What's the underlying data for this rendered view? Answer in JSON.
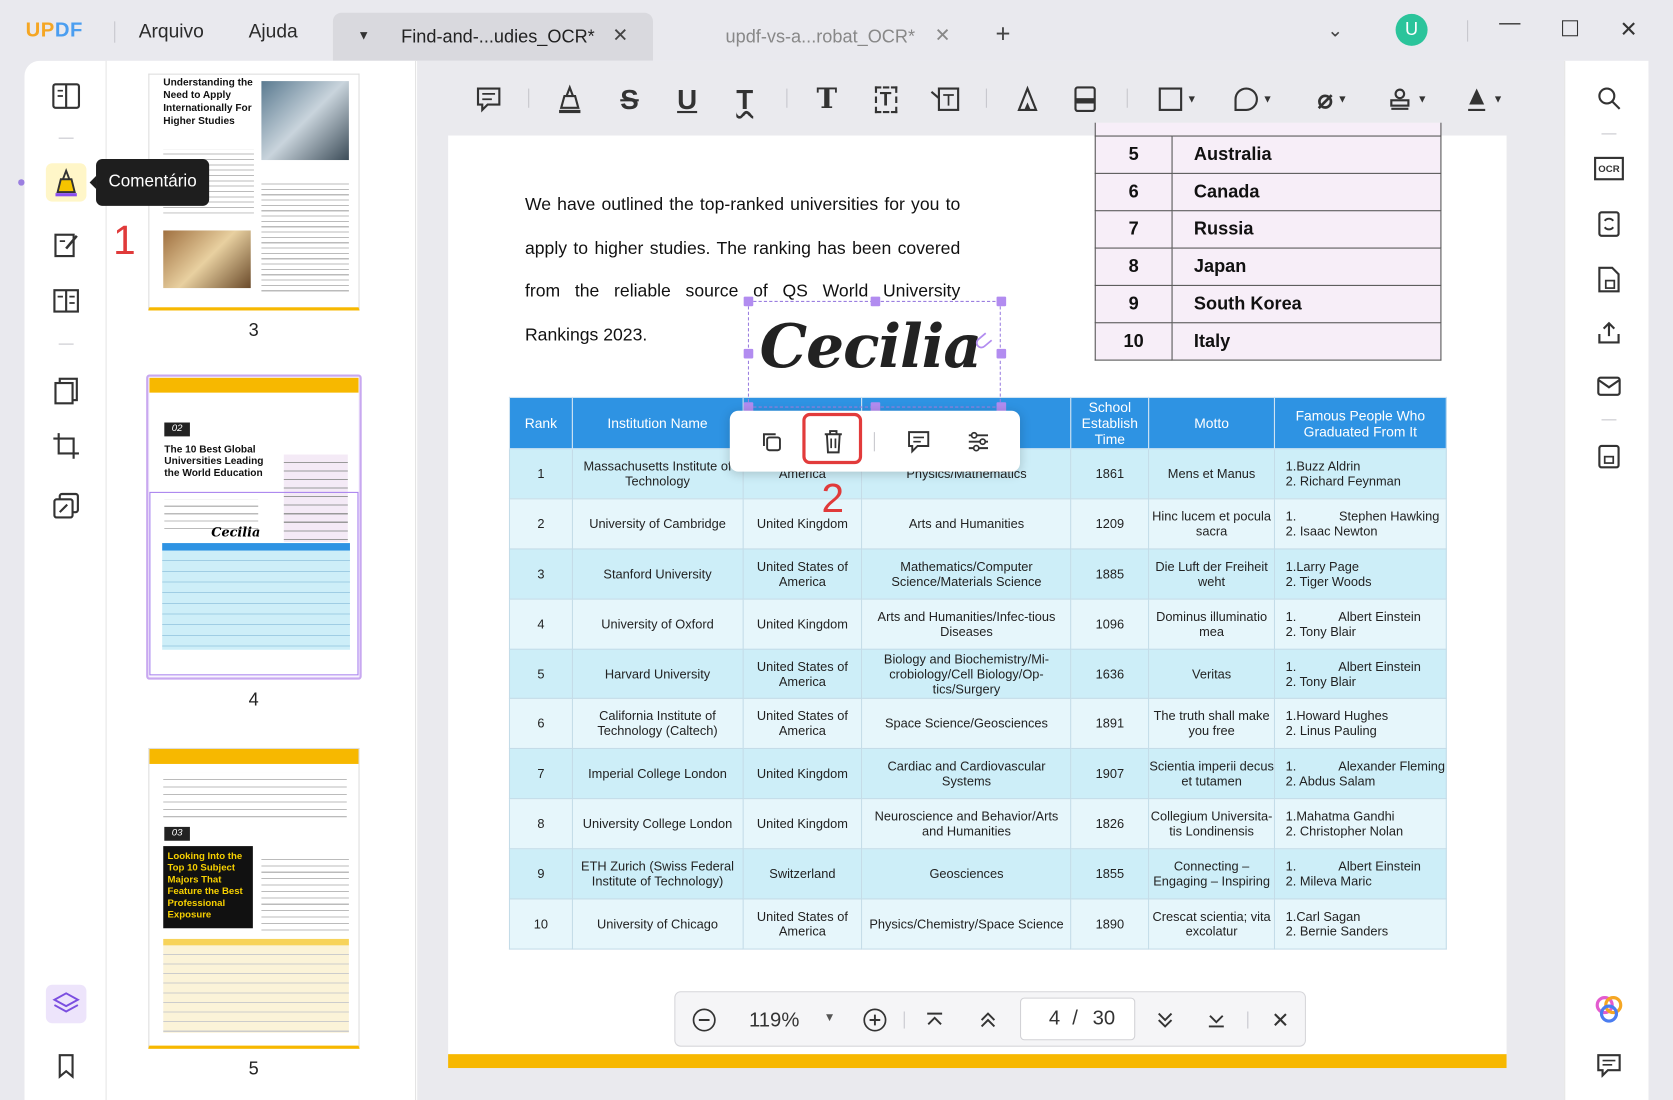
{
  "app": {
    "logo_left": "UP",
    "logo_right": "DF",
    "menu_file": "Arquivo",
    "menu_help": "Ajuda"
  },
  "tabs": [
    {
      "label": "Find-and-...udies_OCR*"
    },
    {
      "label": "updf-vs-a...robat_OCR*"
    }
  ],
  "user": {
    "avatar_letter": "U"
  },
  "tooltip": "Comentário",
  "steps": {
    "one": "1",
    "two": "2"
  },
  "thumbs": {
    "p3_num": "3",
    "p4_num": "4",
    "p5_num": "5",
    "p3_title": "Understanding the Need to Apply Internationally For Higher Studies",
    "p4_badge": "02",
    "p4_title": "The 10 Best Global Universities Leading the World Education",
    "p5_badge": "03",
    "p5_title": "Looking Into the Top 10 Subject Majors That Feature the Best Professional Exposure",
    "p4_sig": "Cecilia"
  },
  "doc": {
    "paragraph": "We have outlined the top-ranked universities for you to apply to higher studies. The ranking has been covered from the reliable source of QS World University Rankings 2023.",
    "signature": "Cecilia",
    "countries": [
      [
        "5",
        "Australia"
      ],
      [
        "6",
        "Canada"
      ],
      [
        "7",
        "Russia"
      ],
      [
        "8",
        "Japan"
      ],
      [
        "9",
        "South Korea"
      ],
      [
        "10",
        "Italy"
      ]
    ],
    "headers": [
      "Rank",
      "Institution Name",
      "",
      "",
      "School Establish Time",
      "Motto",
      "Famous People Who Graduated From It"
    ],
    "rows": [
      [
        "1",
        "Massachusetts Institute of Technology",
        "America",
        "Physics/Mathematics",
        "1861",
        "Mens et Manus",
        "1.Buzz Aldrin\n2. Richard Feynman"
      ],
      [
        "2",
        "University of Cambridge",
        "United Kingdom",
        "Arts and Humanities",
        "1209",
        "Hinc lucem et pocula sacra",
        "1.            Stephen Hawking\n2. Isaac Newton"
      ],
      [
        "3",
        "Stanford University",
        "United States of America",
        "Mathematics/Computer Science/Materials Science",
        "1885",
        "Die Luft der Freiheit weht",
        "1.Larry Page\n2. Tiger Woods"
      ],
      [
        "4",
        "University of Oxford",
        "United Kingdom",
        "Arts and Humanities/Infec-tious Diseases",
        "1096",
        "Dominus illuminatio mea",
        "1.            Albert Einstein\n2. Tony Blair"
      ],
      [
        "5",
        "Harvard University",
        "United States of America",
        "Biology and Biochemistry/Mi-crobiology/Cell Biology/Op-tics/Surgery",
        "1636",
        "Veritas",
        "1.            Albert Einstein\n2. Tony Blair"
      ],
      [
        "6",
        "California Institute of Technology (Caltech)",
        "United States of America",
        "Space Science/Geosciences",
        "1891",
        "The truth shall make you free",
        "1.Howard Hughes\n2. Linus Pauling"
      ],
      [
        "7",
        "Imperial College London",
        "United Kingdom",
        "Cardiac and Cardiovascular Systems",
        "1907",
        "Scientia imperii decus et tutamen",
        "1.            Alexander Fleming\n2. Abdus Salam"
      ],
      [
        "8",
        "University College London",
        "United Kingdom",
        "Neuroscience and Behavior/Arts and Humanities",
        "1826",
        "Collegium Universita-tis Londinensis",
        "1.Mahatma Gandhi\n2. Christopher Nolan"
      ],
      [
        "9",
        "ETH Zurich (Swiss Federal Institute of Technology)",
        "Switzerland",
        "Geosciences",
        "1855",
        "Connecting – Engaging – Inspiring",
        "1.            Albert Einstein\n2. Mileva Maric"
      ],
      [
        "10",
        "University of Chicago",
        "United States of America",
        "Physics/Chemistry/Space Science",
        "1890",
        "Crescat scientia; vita excolatur",
        "1.Carl Sagan\n2. Bernie Sanders"
      ]
    ]
  },
  "zoom": {
    "level": "119%",
    "current_page": "4",
    "separator": "/",
    "total_pages": "30"
  },
  "colors": {
    "accent": "#2e93e3",
    "highlight_red": "#e23b3b",
    "selection": "#b28cf0",
    "yellow": "#f7b800",
    "avatar": "#2bc49b"
  }
}
